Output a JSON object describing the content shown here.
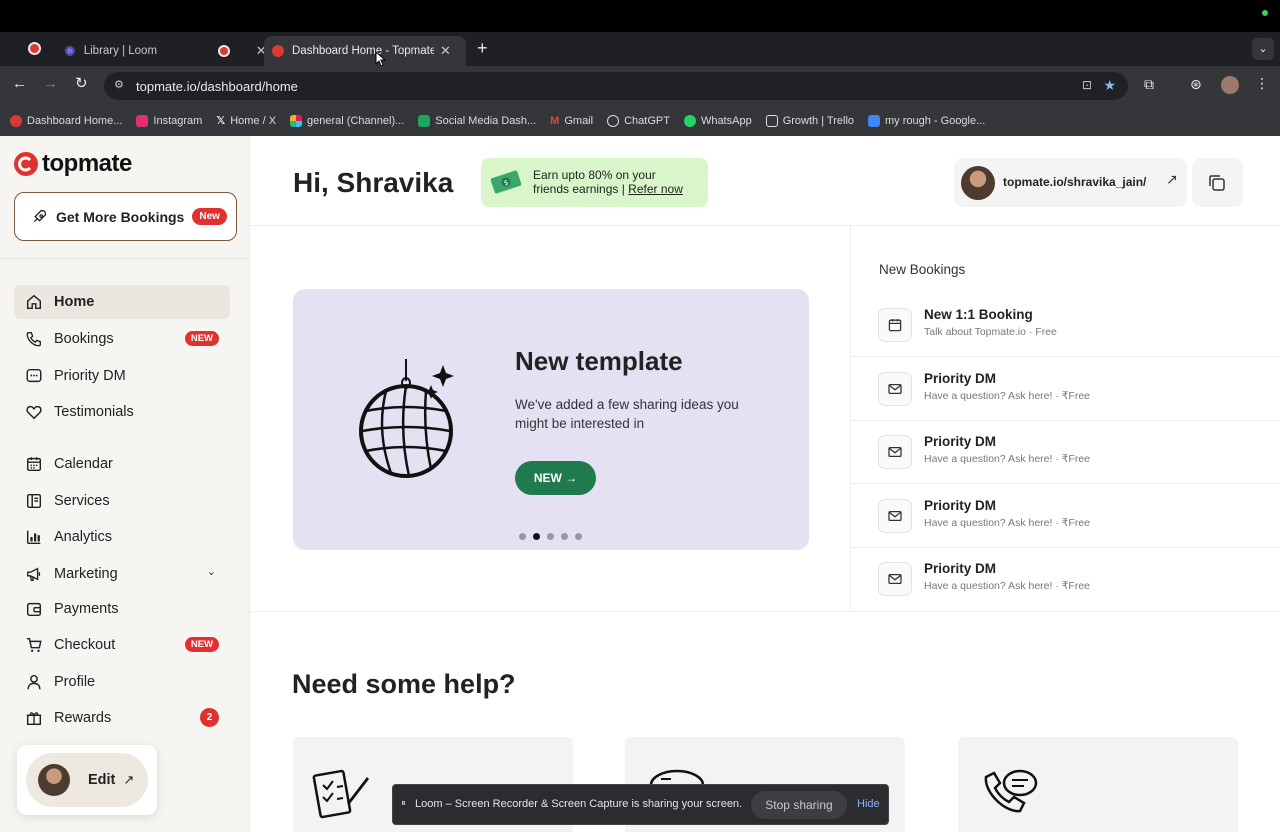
{
  "browser": {
    "tabs": [
      {
        "label": "Library | Loom",
        "icon": "loom-icon"
      },
      {
        "label": "Dashboard Home - Topmate.i",
        "icon": "topmate-icon"
      }
    ],
    "url": "topmate.io/dashboard/home",
    "bookmarks": [
      {
        "label": "Dashboard Home...",
        "color": "#d93a33"
      },
      {
        "label": "Instagram",
        "color": "#e1306c"
      },
      {
        "label": "Home / X",
        "color": "#111111"
      },
      {
        "label": "general (Channel)...",
        "color": "#4a154b"
      },
      {
        "label": "Social Media Dash...",
        "color": "#1fa463"
      },
      {
        "label": "Gmail",
        "color": "#ea4335"
      },
      {
        "label": "ChatGPT",
        "color": "#dddddd"
      },
      {
        "label": "WhatsApp",
        "color": "#25d366"
      },
      {
        "label": "Growth | Trello",
        "color": "#dddddd"
      },
      {
        "label": "my rough - Google...",
        "color": "#4285f4"
      }
    ]
  },
  "brand": {
    "name": "topmate",
    "accent": "#e0302f"
  },
  "sidebar": {
    "cta_label": "Get More Bookings",
    "cta_badge": "New",
    "items": [
      {
        "label": "Home",
        "icon": "home-icon"
      },
      {
        "label": "Bookings",
        "icon": "phone-icon",
        "pill": "NEW"
      },
      {
        "label": "Priority DM",
        "icon": "chat-icon"
      },
      {
        "label": "Testimonials",
        "icon": "heart-icon"
      },
      {
        "label": "Calendar",
        "icon": "calendar-icon"
      },
      {
        "label": "Services",
        "icon": "services-icon"
      },
      {
        "label": "Analytics",
        "icon": "analytics-icon"
      },
      {
        "label": "Marketing",
        "icon": "megaphone-icon"
      },
      {
        "label": "Payments",
        "icon": "wallet-icon"
      },
      {
        "label": "Checkout",
        "icon": "cart-icon",
        "pill": "NEW"
      },
      {
        "label": "Profile",
        "icon": "profile-icon"
      },
      {
        "label": "Rewards",
        "icon": "gift-icon",
        "count": "2"
      }
    ],
    "edit_label": "Edit"
  },
  "header": {
    "greeting": "Hi, Shravika",
    "referral_line1": "Earn upto 80% on your",
    "referral_line2": "friends earnings | ",
    "referral_link": "Refer now",
    "profile_link": "topmate.io/shravika_jain/"
  },
  "banner": {
    "title": "New template",
    "text_line1": "We've added a few sharing ideas you",
    "text_line2": "might be interested in",
    "button_label": "NEW →",
    "active_dot": 1,
    "dot_count": 5,
    "bg": "#e6e0f3",
    "button_color": "#1f7a4d"
  },
  "new_bookings": {
    "heading": "New Bookings",
    "items": [
      {
        "title": "New 1:1 Booking",
        "sub": "Talk about Topmate.io · Free",
        "icon": "calendar-icon"
      },
      {
        "title": "Priority DM",
        "sub": "Have a question? Ask here! · ₹Free",
        "icon": "mail-icon"
      },
      {
        "title": "Priority DM",
        "sub": "Have a question? Ask here! · ₹Free",
        "icon": "mail-icon"
      },
      {
        "title": "Priority DM",
        "sub": "Have a question? Ask here! · ₹Free",
        "icon": "mail-icon"
      },
      {
        "title": "Priority DM",
        "sub": "Have a question? Ask here! · ₹Free",
        "icon": "mail-icon"
      }
    ]
  },
  "help": {
    "heading": "Need some help?"
  },
  "share_bar": {
    "message": "Loom – Screen Recorder & Screen Capture is sharing your screen.",
    "stop_label": "Stop sharing",
    "hide_label": "Hide"
  }
}
